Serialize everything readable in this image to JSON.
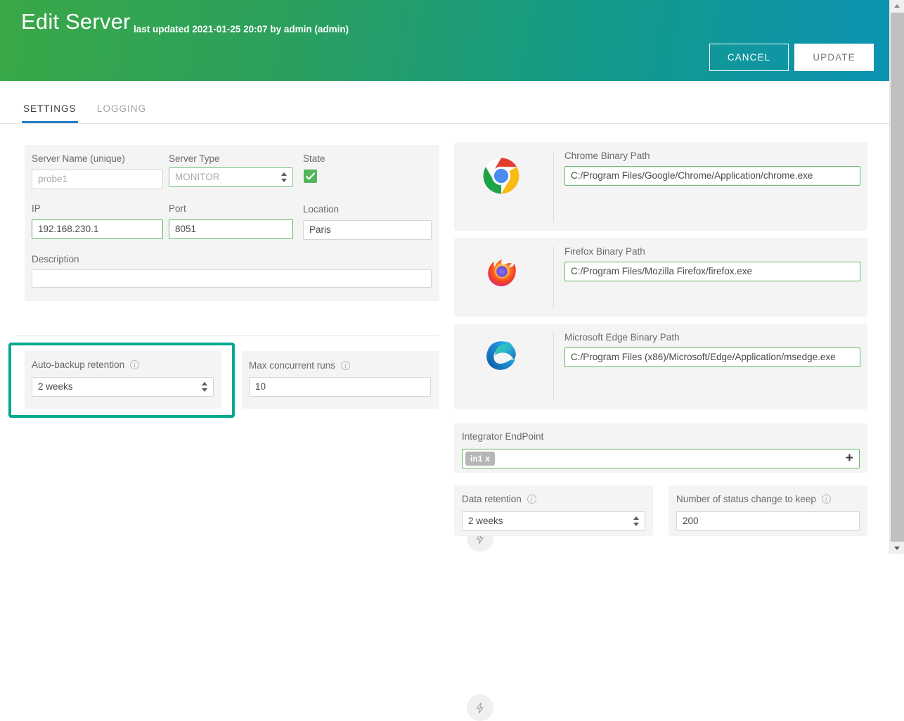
{
  "header": {
    "title": "Edit Server",
    "subtitle": "last updated 2021-01-25 20:07 by admin (admin)",
    "cancel_label": "CANCEL",
    "update_label": "UPDATE",
    "gradient_from": "#3aa847",
    "gradient_to": "#0c93b3"
  },
  "tabs": [
    {
      "label": "SETTINGS",
      "active": true,
      "accent": "#2a7fc9"
    },
    {
      "label": "LOGGING",
      "active": false
    }
  ],
  "settings": {
    "server": {
      "server_name": {
        "label": "Server Name (unique)",
        "value": "probe1",
        "is_placeholder": true
      },
      "server_type": {
        "label": "Server Type",
        "value": "MONITOR",
        "is_placeholder": true
      },
      "state": {
        "label": "State",
        "checked": true,
        "color": "#51b65a"
      },
      "ip": {
        "label": "IP",
        "value": "192.168.230.1"
      },
      "port": {
        "label": "Port",
        "value": "8051"
      },
      "location": {
        "label": "Location",
        "value": "Paris"
      },
      "description": {
        "label": "Description",
        "value": ""
      }
    },
    "auto_backup_retention": {
      "label": "Auto-backup retention",
      "value": "2 weeks",
      "highlighted": true,
      "highlight_color": "#00a990"
    },
    "max_concurrent_runs": {
      "label": "Max concurrent runs",
      "value": "10"
    },
    "browsers": [
      {
        "name": "chrome",
        "logo": "chrome-logo",
        "bolt": "lightning-bolt-icon",
        "label": "Chrome Binary Path",
        "value": "C:/Program Files/Google/Chrome/Application/chrome.exe"
      },
      {
        "name": "firefox",
        "logo": "firefox-logo",
        "bolt": "lightning-bolt-icon",
        "label": "Firefox Binary Path",
        "value": "C:/Program Files/Mozilla Firefox/firefox.exe"
      },
      {
        "name": "edge",
        "logo": "edge-logo",
        "bolt": "lightning-bolt-icon",
        "label": "Microsoft Edge Binary Path",
        "value": "C:/Program Files (x86)/Microsoft/Edge/Application/msedge.exe"
      }
    ],
    "integrator_endpoint": {
      "label": "Integrator EndPoint",
      "chips": [
        {
          "text": "in1",
          "remove": "x"
        }
      ],
      "add_label": "+"
    },
    "data_retention": {
      "label": "Data retention",
      "value": "2 weeks"
    },
    "status_change_to_keep": {
      "label": "Number of status change to keep",
      "value": "200"
    }
  },
  "scrollbar": {
    "up": "scroll-up-arrow",
    "down": "scroll-down-arrow"
  }
}
